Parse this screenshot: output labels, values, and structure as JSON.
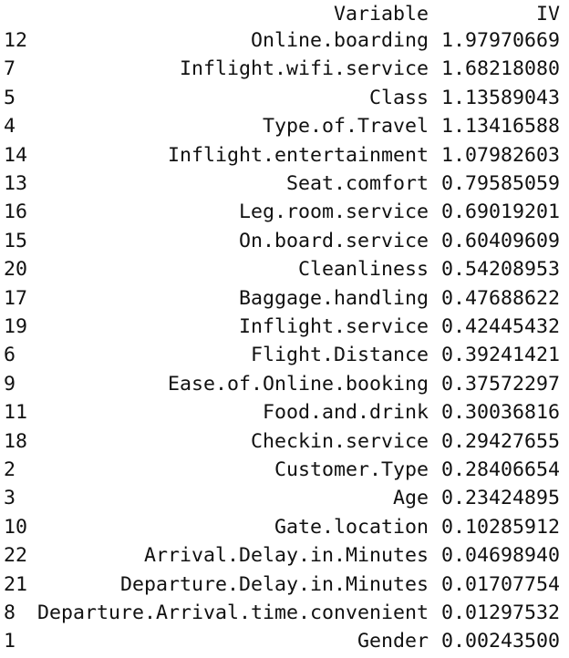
{
  "table": {
    "header": {
      "variable": "Variable",
      "iv": "IV"
    },
    "rows": [
      {
        "index": "12",
        "variable": "Online.boarding",
        "iv": "1.97970669"
      },
      {
        "index": "7",
        "variable": "Inflight.wifi.service",
        "iv": "1.68218080"
      },
      {
        "index": "5",
        "variable": "Class",
        "iv": "1.13589043"
      },
      {
        "index": "4",
        "variable": "Type.of.Travel",
        "iv": "1.13416588"
      },
      {
        "index": "14",
        "variable": "Inflight.entertainment",
        "iv": "1.07982603"
      },
      {
        "index": "13",
        "variable": "Seat.comfort",
        "iv": "0.79585059"
      },
      {
        "index": "16",
        "variable": "Leg.room.service",
        "iv": "0.69019201"
      },
      {
        "index": "15",
        "variable": "On.board.service",
        "iv": "0.60409609"
      },
      {
        "index": "20",
        "variable": "Cleanliness",
        "iv": "0.54208953"
      },
      {
        "index": "17",
        "variable": "Baggage.handling",
        "iv": "0.47688622"
      },
      {
        "index": "19",
        "variable": "Inflight.service",
        "iv": "0.42445432"
      },
      {
        "index": "6",
        "variable": "Flight.Distance",
        "iv": "0.39241421"
      },
      {
        "index": "9",
        "variable": "Ease.of.Online.booking",
        "iv": "0.37572297"
      },
      {
        "index": "11",
        "variable": "Food.and.drink",
        "iv": "0.30036816"
      },
      {
        "index": "18",
        "variable": "Checkin.service",
        "iv": "0.29427655"
      },
      {
        "index": "2",
        "variable": "Customer.Type",
        "iv": "0.28406654"
      },
      {
        "index": "3",
        "variable": "Age",
        "iv": "0.23424895"
      },
      {
        "index": "10",
        "variable": "Gate.location",
        "iv": "0.10285912"
      },
      {
        "index": "22",
        "variable": "Arrival.Delay.in.Minutes",
        "iv": "0.04698940"
      },
      {
        "index": "21",
        "variable": "Departure.Delay.in.Minutes",
        "iv": "0.01707754"
      },
      {
        "index": "8",
        "variable": "Departure.Arrival.time.convenient",
        "iv": "0.01297532"
      },
      {
        "index": "1",
        "variable": "Gender",
        "iv": "0.00243500"
      }
    ]
  }
}
